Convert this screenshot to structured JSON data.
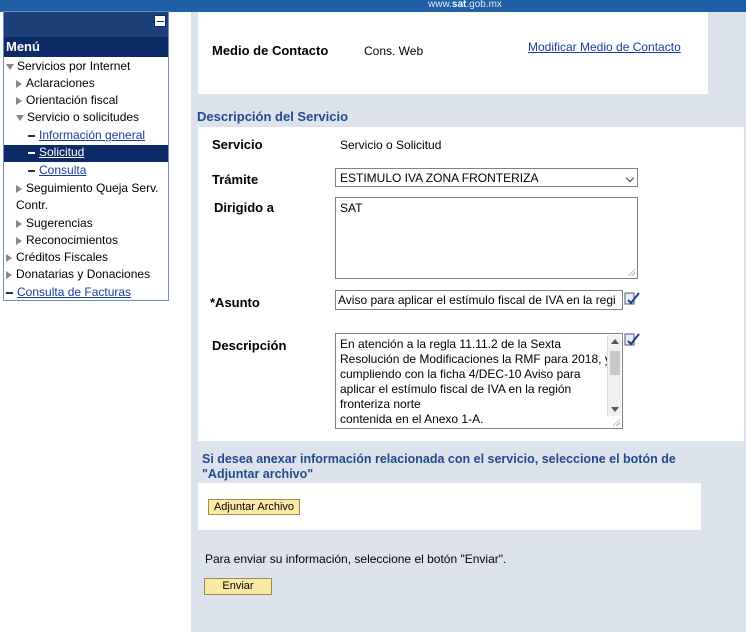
{
  "browser": {
    "url_prefix": "www.",
    "url_bold": "sat",
    "url_suffix": ".gob.mx"
  },
  "sidebar": {
    "menu_title": "Menú",
    "items": [
      {
        "label": "Servicios por Internet"
      },
      {
        "label": "Aclaraciones"
      },
      {
        "label": "Orientación fiscal"
      },
      {
        "label": "Servicio o solicitudes"
      },
      {
        "label": "Información general"
      },
      {
        "label": "Solicitud"
      },
      {
        "label": "Consulta"
      },
      {
        "label_line1": "Seguimiento Queja Serv.",
        "label_line2": "Contr."
      },
      {
        "label": "Sugerencias"
      },
      {
        "label": "Reconocimientos"
      },
      {
        "label": "Créditos Fiscales"
      },
      {
        "label": "Donatarias y Donaciones"
      },
      {
        "label": "Consulta de Facturas"
      }
    ]
  },
  "contact": {
    "label": "Medio de Contacto",
    "value": "Cons. Web",
    "modify_link": "Modificar Medio de Contacto"
  },
  "service": {
    "section_title": "Descripción del Servicio",
    "servicio_label": "Servicio",
    "servicio_value": "Servicio o Solicitud",
    "tramite_label": "Trámite",
    "tramite_value": "ESTIMULO IVA ZONA FRONTERIZA",
    "dirigido_label": "Dirigido a",
    "dirigido_value": "SAT",
    "asunto_label": "*Asunto",
    "asunto_value": "Aviso para aplicar el estímulo fiscal de IVA en la regi",
    "descripcion_label": "Descripción",
    "descripcion_lines": [
      "En atención a la regla 11.11.2 de la Sexta",
      "Resolución de Modificaciones la RMF para 2018, y",
      "cumpliendo con la ficha 4/DEC-10 Aviso para",
      "aplicar el estímulo fiscal de IVA en la región",
      "fronteriza norte",
      "contenida en el Anexo 1-A."
    ]
  },
  "attach": {
    "title_line1": "Si desea anexar información relacionada con el servicio, seleccione el botón de",
    "title_line2": "\"Adjuntar archivo\"",
    "button": "Adjuntar Archivo"
  },
  "send": {
    "note": "Para enviar su información, seleccione el botón \"Enviar\".",
    "button": "Enviar"
  }
}
